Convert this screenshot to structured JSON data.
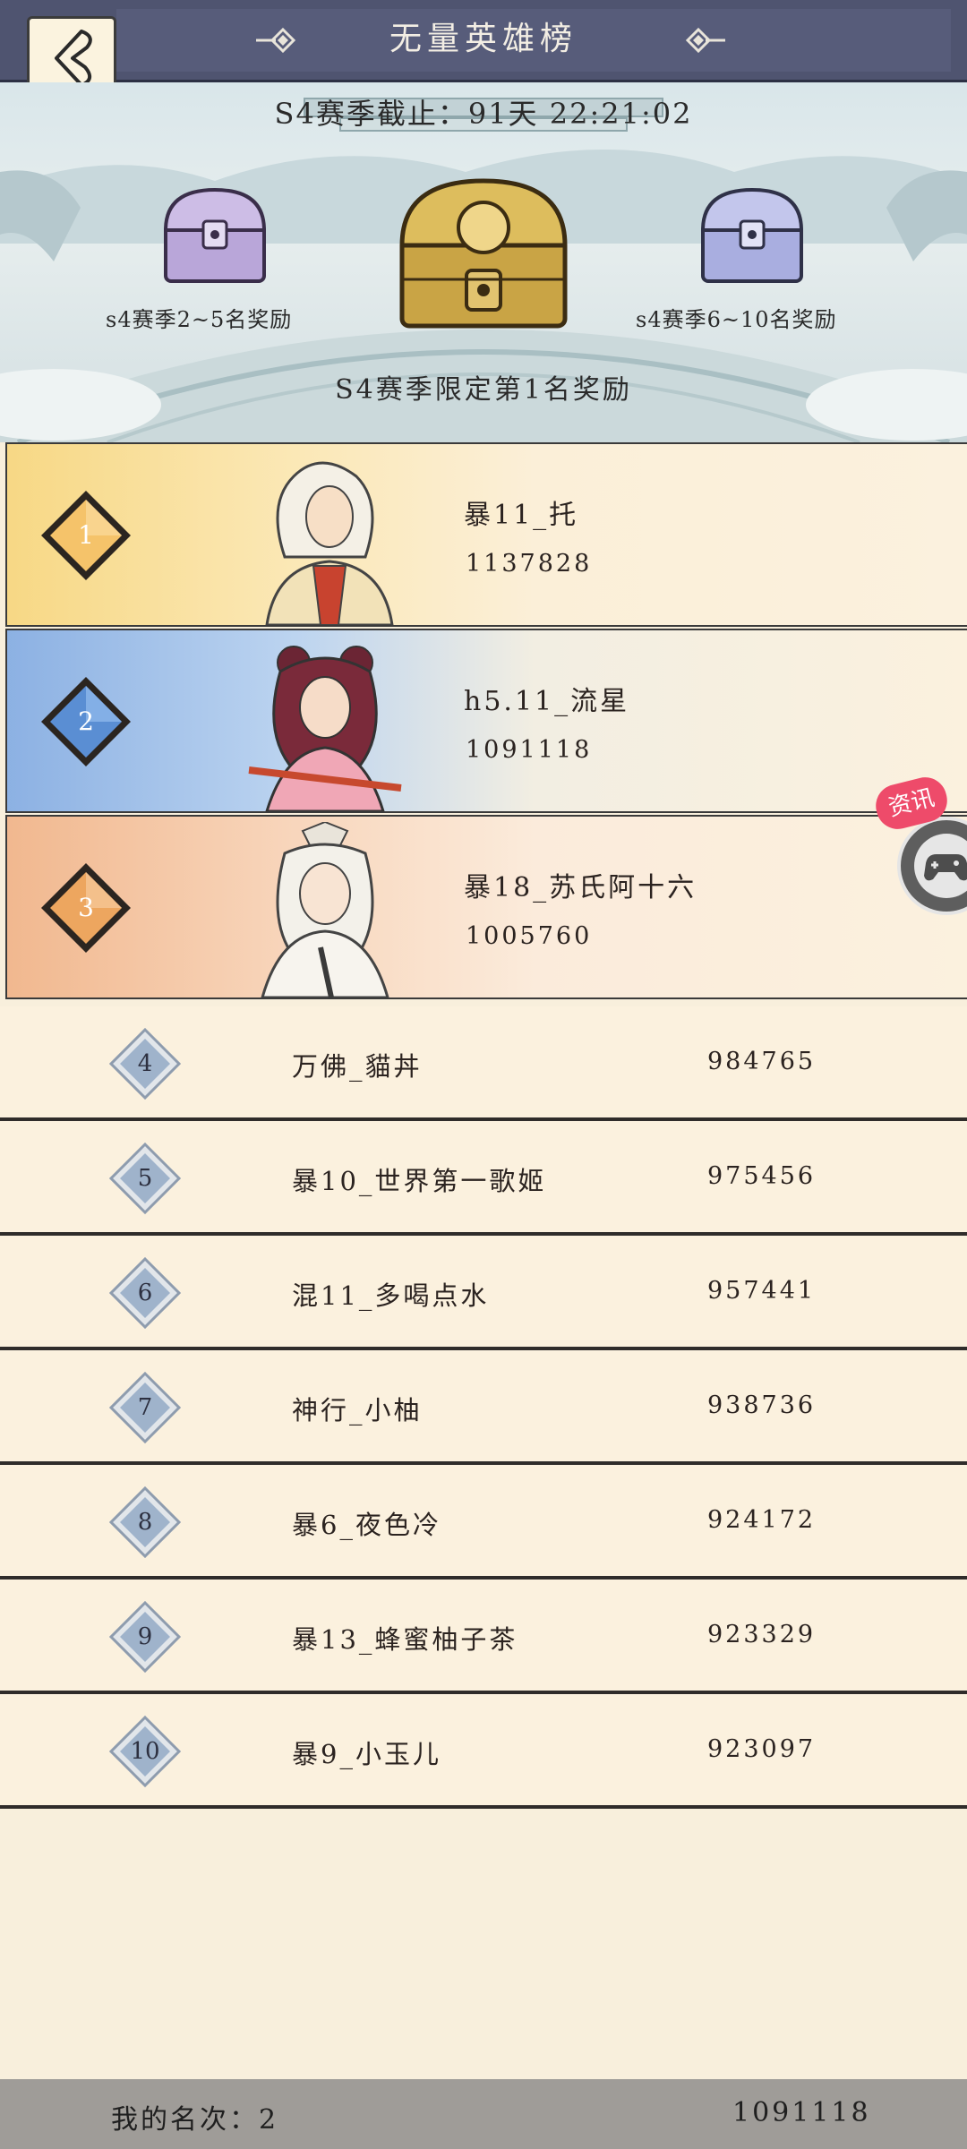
{
  "header": {
    "title": "无量英雄榜"
  },
  "banner": {
    "countdown": "S4赛季截止：91天 22:21:02",
    "left_chest_label": "s4赛季2~5名奖励",
    "right_chest_label": "s4赛季6~10名奖励",
    "main_reward_label": "S4赛季限定第1名奖励"
  },
  "top3": [
    {
      "rank": "1",
      "name": "暴11_托",
      "score": "1137828"
    },
    {
      "rank": "2",
      "name": "h5.11_流星",
      "score": "1091118"
    },
    {
      "rank": "3",
      "name": "暴18_苏氏阿十六",
      "score": "1005760"
    }
  ],
  "list": [
    {
      "rank": "4",
      "name": "万佛_貓丼",
      "score": "984765"
    },
    {
      "rank": "5",
      "name": "暴10_世界第一歌姬",
      "score": "975456"
    },
    {
      "rank": "6",
      "name": "混11_多喝点水",
      "score": "957441"
    },
    {
      "rank": "7",
      "name": "神行_小柚",
      "score": "938736"
    },
    {
      "rank": "8",
      "name": "暴6_夜色冷",
      "score": "924172"
    },
    {
      "rank": "9",
      "name": "暴13_蜂蜜柚子茶",
      "score": "923329"
    },
    {
      "rank": "10",
      "name": "暴9_小玉儿",
      "score": "923097"
    }
  ],
  "footer": {
    "my_rank": "我的名次：2",
    "my_score": "1091118"
  },
  "news": {
    "label": "资讯"
  },
  "colors": {
    "header_bg": "#4f5470",
    "gold_chest": "#c9a445",
    "purple_chest": "#b9a6d9",
    "rank_list_diamond": "#9fb3cb"
  }
}
